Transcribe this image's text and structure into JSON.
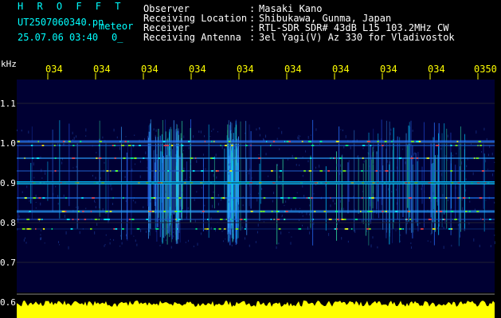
{
  "header": {
    "title": "H R O F F T",
    "filename": "UT2507060340.pn",
    "meteor_label": "meteor",
    "datetime": "25.07.06 03:40",
    "counter": "0_"
  },
  "info": [
    {
      "label": "Observer",
      "sep": ":",
      "value": "Masaki Kano"
    },
    {
      "label": "Receiving Location",
      "sep": ":",
      "value": "Shibukawa, Gunma, Japan"
    },
    {
      "label": "Receiver",
      "sep": ":",
      "value": "RTL-SDR SDR# 43dB L15 103.2MHz CW"
    },
    {
      "label": "Receiving Antenna",
      "sep": ":",
      "value": "3el Yagi(V) Az 330 for Vladivostok"
    }
  ],
  "axis": {
    "y_unit": "kHz",
    "x_ticks": [
      "034",
      "034",
      "034",
      "034",
      "034",
      "034",
      "034",
      "034",
      "034",
      "0350"
    ],
    "y_ticks": [
      "1.1",
      "1.0",
      "0.9",
      "0.8",
      "0.7",
      "0.6"
    ]
  },
  "colors": {
    "background": "#000000",
    "plot_background": "#000033",
    "label_yellow": "#ffff00",
    "noise_floor": "#ffff00"
  }
}
